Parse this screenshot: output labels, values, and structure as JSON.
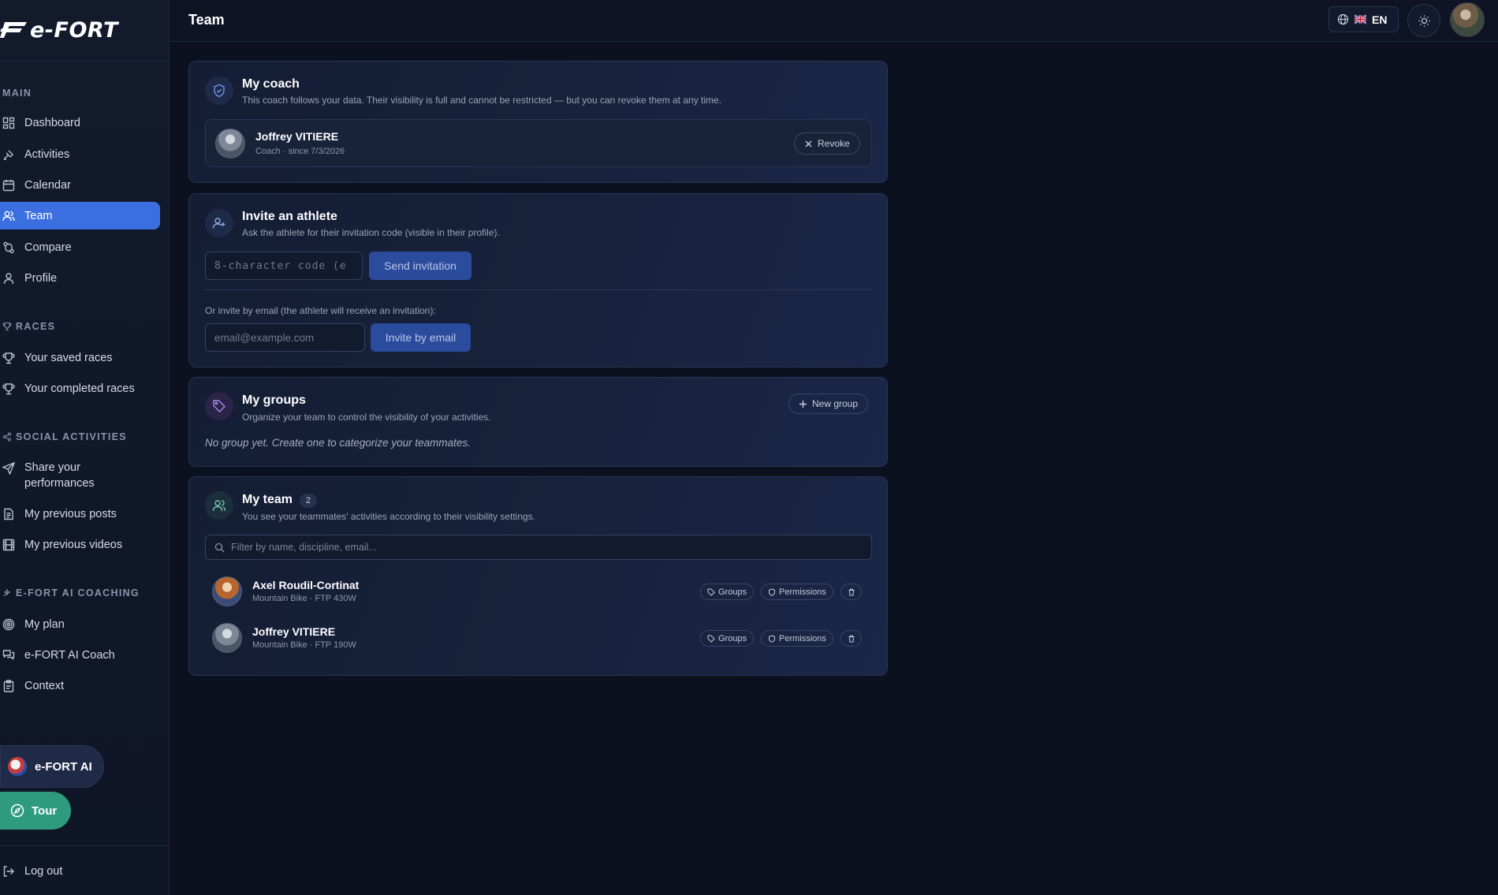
{
  "app": {
    "logo_text": "e-FORT"
  },
  "header": {
    "title": "Team",
    "language": "EN"
  },
  "sidebar": {
    "sections": {
      "main": "MAIN",
      "races": "RACES",
      "social": "SOCIAL ACTIVITIES",
      "coaching": "E-FORT AI COACHING"
    },
    "main_items": [
      {
        "label": "Dashboard",
        "icon": "dashboard-icon"
      },
      {
        "label": "Activities",
        "icon": "activities-icon"
      },
      {
        "label": "Calendar",
        "icon": "calendar-icon"
      },
      {
        "label": "Team",
        "icon": "team-icon",
        "active": true
      },
      {
        "label": "Compare",
        "icon": "compare-icon"
      },
      {
        "label": "Profile",
        "icon": "profile-icon"
      }
    ],
    "race_items": [
      {
        "label": "Your saved races",
        "icon": "trophy-icon"
      },
      {
        "label": "Your completed races",
        "icon": "trophy-icon"
      }
    ],
    "social_items": [
      {
        "label_line1": "Share your",
        "label_line2": "performances",
        "icon": "send-icon"
      },
      {
        "label": "My previous posts",
        "icon": "document-icon"
      },
      {
        "label": "My previous videos",
        "icon": "film-icon"
      }
    ],
    "coaching_items": [
      {
        "label": "My plan",
        "icon": "target-icon"
      },
      {
        "label": "e-FORT AI Coach",
        "icon": "chat-icon"
      },
      {
        "label": "Context",
        "icon": "clipboard-icon"
      }
    ],
    "ai_button": "e-FORT AI",
    "tour_button": "Tour",
    "logout": "Log out"
  },
  "coach_card": {
    "title": "My coach",
    "subtitle": "This coach follows your data. Their visibility is full and cannot be restricted — but you can revoke them at any time.",
    "coach_name": "Joffrey VITIERE",
    "coach_meta": "Coach · since 7/3/2026",
    "revoke_label": "Revoke"
  },
  "invite_card": {
    "title": "Invite an athlete",
    "subtitle": "Ask the athlete for their invitation code (visible in their profile).",
    "code_placeholder": "8-character code (e",
    "send_label": "Send invitation",
    "email_note": "Or invite by email (the athlete will receive an invitation):",
    "email_placeholder": "email@example.com",
    "email_button": "Invite by email"
  },
  "groups_card": {
    "title": "My groups",
    "subtitle": "Organize your team to control the visibility of your activities.",
    "new_group_label": "New group",
    "empty_text": "No group yet. Create one to categorize your teammates."
  },
  "team_card": {
    "title": "My team",
    "count": "2",
    "subtitle": "You see your teammates' activities according to their visibility settings.",
    "search_placeholder": "Filter by name, discipline, email...",
    "groups_label": "Groups",
    "permissions_label": "Permissions",
    "members": [
      {
        "name": "Axel Roudil-Cortinat",
        "meta": "Mountain Bike · FTP 430W"
      },
      {
        "name": "Joffrey VITIERE",
        "meta": "Mountain Bike · FTP 190W"
      }
    ]
  },
  "colors": {
    "accent": "#3b6fe0",
    "tour": "#2e9b7f",
    "background": "#0c1120"
  }
}
